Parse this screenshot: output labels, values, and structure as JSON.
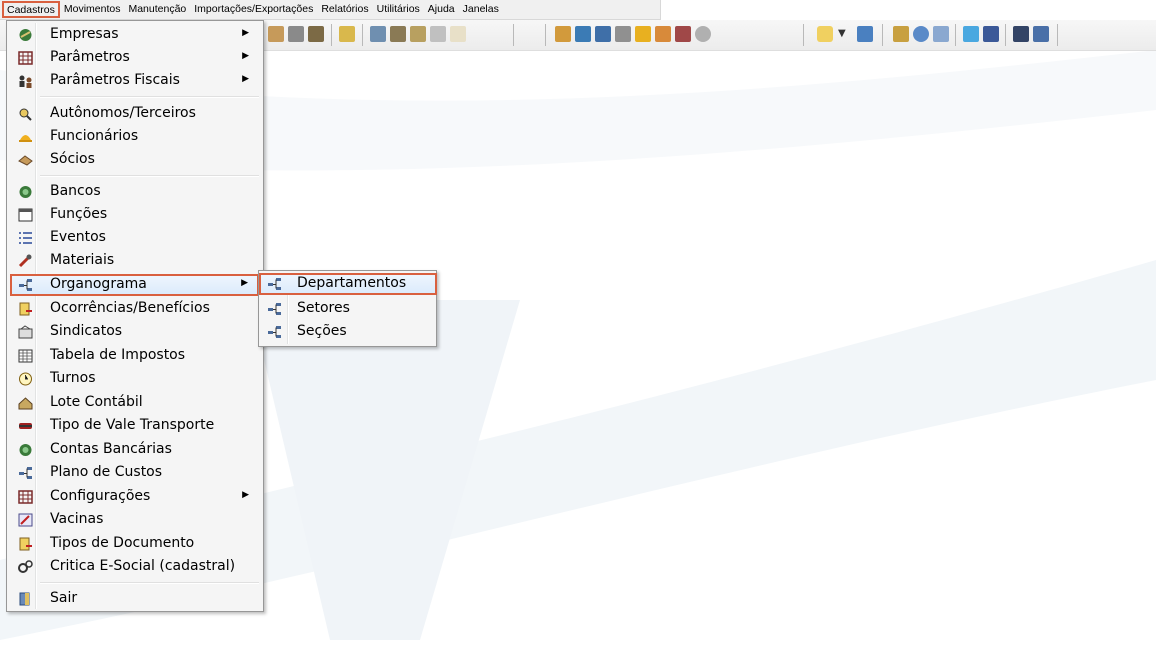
{
  "menubar": {
    "items": [
      {
        "label": "Cadastros"
      },
      {
        "label": "Movimentos"
      },
      {
        "label": "Manutenção"
      },
      {
        "label": "Importações/Exportações"
      },
      {
        "label": "Relatórios"
      },
      {
        "label": "Utilitários"
      },
      {
        "label": "Ajuda"
      },
      {
        "label": "Janelas"
      }
    ]
  },
  "cadastros_menu": {
    "items": [
      {
        "label": "Empresas",
        "icon": "empresas-icon",
        "submenu": true
      },
      {
        "label": "Parâmetros",
        "icon": "grid-icon",
        "submenu": true
      },
      {
        "label": "Parâmetros Fiscais",
        "icon": "people-icon",
        "submenu": true
      },
      {
        "label": "Autônomos/Terceiros",
        "icon": "person-search-icon"
      },
      {
        "label": "Funcionários",
        "icon": "helmet-icon"
      },
      {
        "label": "Sócios",
        "icon": "handshake-icon"
      },
      {
        "label": "Bancos",
        "icon": "bank-icon"
      },
      {
        "label": "Funções",
        "icon": "window-icon"
      },
      {
        "label": "Eventos",
        "icon": "list-icon"
      },
      {
        "label": "Materiais",
        "icon": "tools-icon"
      },
      {
        "label": "Organograma",
        "icon": "org-chart-icon",
        "submenu": true
      },
      {
        "label": "Ocorrências/Benefícios",
        "icon": "doc-arrow-icon"
      },
      {
        "label": "Sindicatos",
        "icon": "union-icon"
      },
      {
        "label": "Tabela de Impostos",
        "icon": "table-icon"
      },
      {
        "label": "Turnos",
        "icon": "clock-icon"
      },
      {
        "label": "Lote Contábil",
        "icon": "ledger-icon"
      },
      {
        "label": "Tipo de Vale Transporte",
        "icon": "bus-icon"
      },
      {
        "label": "Contas Bancárias",
        "icon": "bank-accounts-icon"
      },
      {
        "label": "Plano de Custos",
        "icon": "org-chart-icon"
      },
      {
        "label": "Configurações",
        "icon": "grid-icon",
        "submenu": true
      },
      {
        "label": "Vacinas",
        "icon": "vaccine-icon"
      },
      {
        "label": "Tipos de Documento",
        "icon": "doc-arrow-icon"
      },
      {
        "label": "Critica E-Social (cadastral)",
        "icon": "gears-icon"
      },
      {
        "label": "Sair",
        "icon": "exit-door-icon"
      }
    ]
  },
  "organograma_submenu": {
    "items": [
      {
        "label": "Departamentos",
        "icon": "org-chart-icon"
      },
      {
        "label": "Setores",
        "icon": "org-chart-icon"
      },
      {
        "label": "Seções",
        "icon": "org-chart-icon"
      }
    ]
  },
  "colors": {
    "highlight_border": "#d9603f",
    "menu_bg": "#f5f5f5"
  }
}
